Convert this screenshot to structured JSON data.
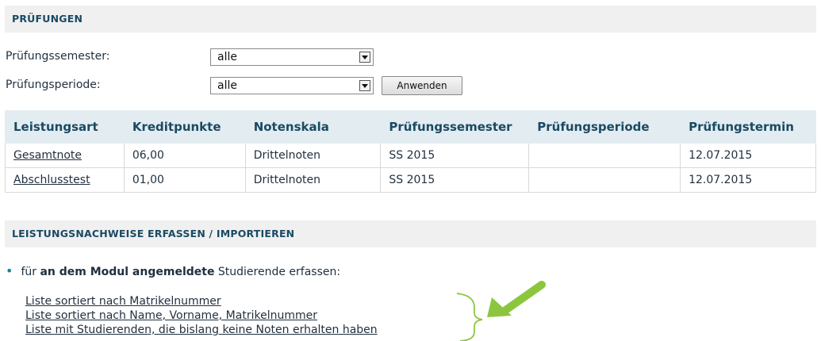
{
  "sections": {
    "exams_title": "PRÜFUNGEN",
    "records_title": "LEISTUNGSNACHWEISE ERFASSEN / IMPORTIEREN"
  },
  "filters": {
    "semester_label": "Prüfungssemester:",
    "semester_value": "alle",
    "period_label": "Prüfungsperiode:",
    "period_value": "alle",
    "apply_label": "Anwenden"
  },
  "table": {
    "headers": [
      "Leistungsart",
      "Kreditpunkte",
      "Notenskala",
      "Prüfungssemester",
      "Prüfungsperiode",
      "Prüfungstermin"
    ],
    "rows": [
      [
        "Gesamtnote",
        "06,00",
        "Drittelnoten",
        "SS 2015",
        "",
        "12.07.2015"
      ],
      [
        "Abschlusstest",
        "01,00",
        "Drittelnoten",
        "SS 2015",
        "",
        "12.07.2015"
      ]
    ]
  },
  "records": {
    "bullet_prefix": "für",
    "bullet_bold": "an dem Modul angemeldete",
    "bullet_suffix": "Studierende erfassen:",
    "links": [
      "Liste sortiert nach Matrikelnummer",
      "Liste sortiert nach Name, Vorname, Matrikelnummer",
      "Liste mit Studierenden, die bislang keine Noten erhalten haben"
    ]
  },
  "colors": {
    "header_text": "#1a4a63",
    "section_bg": "#f0f0f0",
    "table_header_bg": "#e3ecf1",
    "annotation_green": "#8cc63f"
  }
}
